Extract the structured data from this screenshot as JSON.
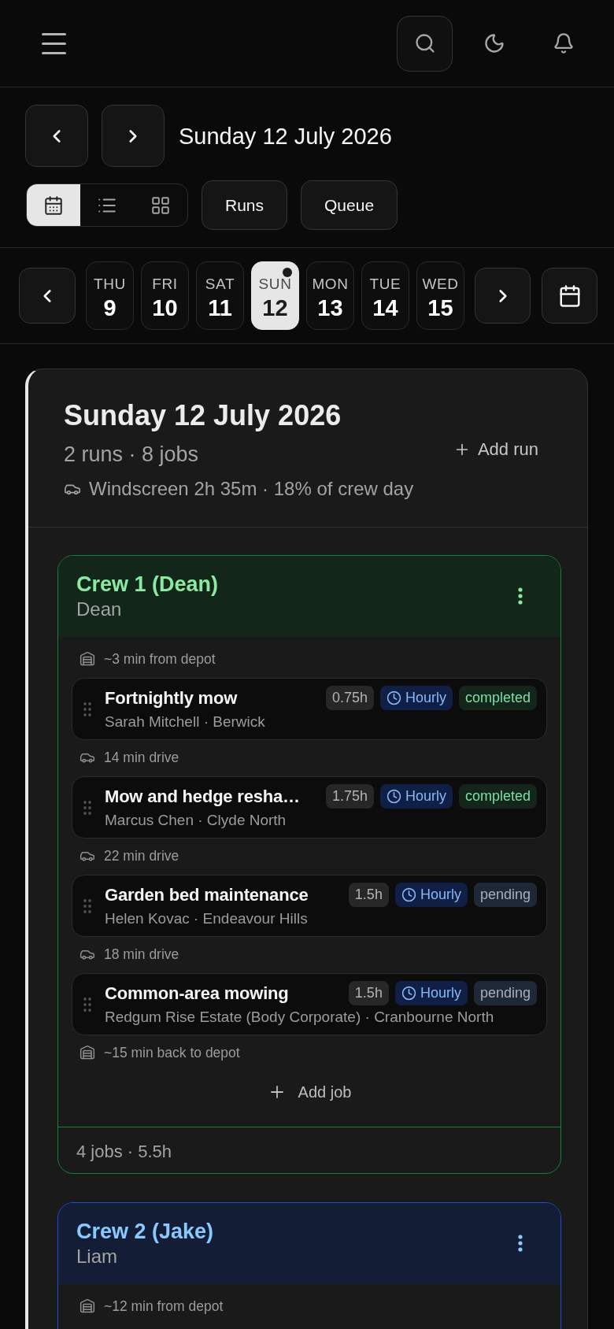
{
  "date_nav": {
    "title": "Sunday 12 July 2026"
  },
  "view_modes": [
    {
      "kind": "calendar",
      "selected": true
    },
    {
      "kind": "list",
      "selected": false
    },
    {
      "kind": "grid",
      "selected": false
    }
  ],
  "actions": [
    {
      "label": "Runs"
    },
    {
      "label": "Queue"
    }
  ],
  "week": [
    {
      "weekday": "THU",
      "day": "9",
      "selected": false,
      "dot": false
    },
    {
      "weekday": "FRI",
      "day": "10",
      "selected": false,
      "dot": false
    },
    {
      "weekday": "SAT",
      "day": "11",
      "selected": false,
      "dot": false
    },
    {
      "weekday": "SUN",
      "day": "12",
      "selected": true,
      "dot": true
    },
    {
      "weekday": "MON",
      "day": "13",
      "selected": false,
      "dot": false
    },
    {
      "weekday": "TUE",
      "day": "14",
      "selected": false,
      "dot": false
    },
    {
      "weekday": "WED",
      "day": "15",
      "selected": false,
      "dot": false
    }
  ],
  "day_card": {
    "title": "Sunday 12 July 2026",
    "summary": "2 runs · 8 jobs",
    "windscreen": "Windscreen 2h 35m · 18% of crew day",
    "add_run": "Add run",
    "runs": [
      {
        "name": "Crew 1 (Dean)",
        "driver": "Dean",
        "color": "#15803d",
        "stops": [
          {
            "kind": "depot",
            "text": "~3 min from depot"
          },
          {
            "kind": "job",
            "title": "Fortnightly mow",
            "client": "Sarah Mitchell · Berwick",
            "hours": "0.75h",
            "billing": "Hourly",
            "status": "completed",
            "done": true
          },
          {
            "kind": "drive",
            "text": "14 min drive"
          },
          {
            "kind": "job",
            "title": "Mow and hedge resha…",
            "client": "Marcus Chen · Clyde North",
            "hours": "1.75h",
            "billing": "Hourly",
            "status": "completed",
            "done": true
          },
          {
            "kind": "drive",
            "text": "22 min drive"
          },
          {
            "kind": "job",
            "title": "Garden bed maintenance",
            "client": "Helen Kovac · Endeavour Hills",
            "hours": "1.5h",
            "billing": "Hourly",
            "status": "pending",
            "done": false
          },
          {
            "kind": "drive",
            "text": "18 min drive"
          },
          {
            "kind": "job",
            "title": "Common-area mowing",
            "client": "Redgum Rise Estate (Body Corporate) · Cranbourne North",
            "hours": "1.5h",
            "billing": "Hourly",
            "status": "pending",
            "done": false
          },
          {
            "kind": "depot",
            "text": "~15 min back to depot"
          }
        ],
        "add_job": "Add job",
        "footer": "4 jobs · 5.5h"
      },
      {
        "name": "Crew 2 (Jake)",
        "driver": "Liam",
        "color": "#1d4ed8",
        "stops": [
          {
            "kind": "depot",
            "text": "~12 min from depot"
          }
        ]
      }
    ]
  }
}
